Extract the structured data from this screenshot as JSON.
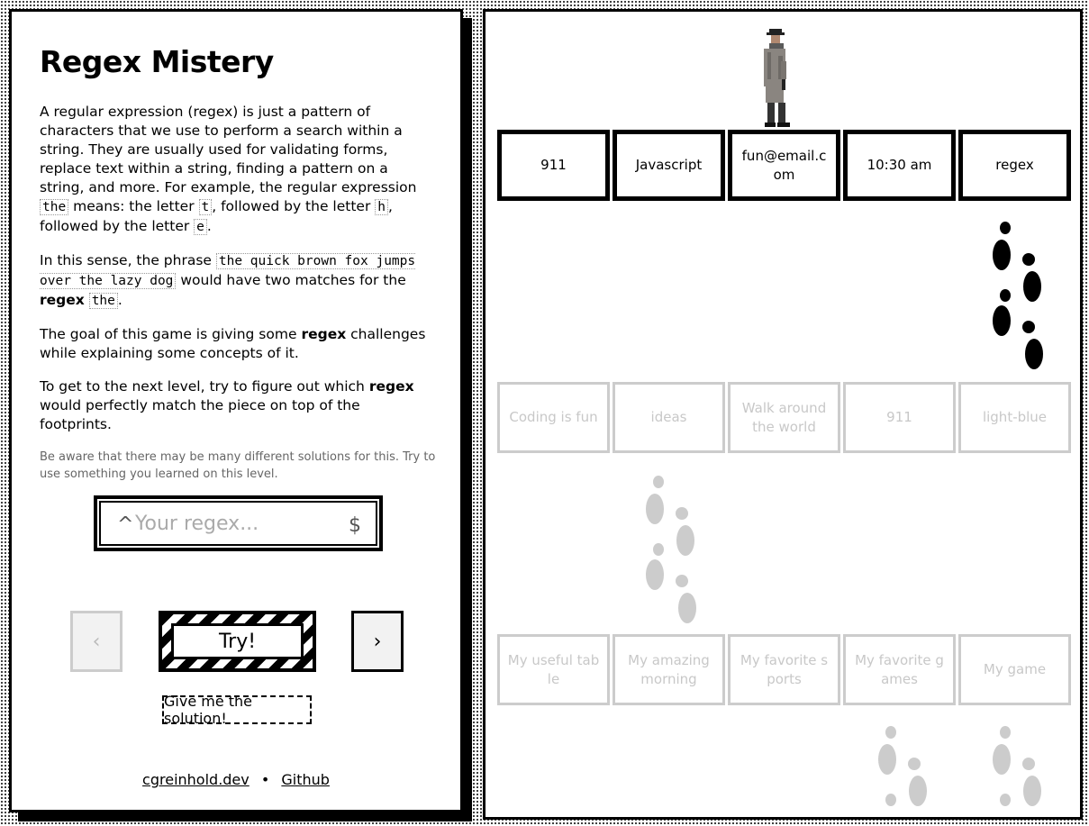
{
  "intro": {
    "title": "Regex Mistery",
    "p1_a": "A regular expression (regex) is just a pattern of characters that we use to perform a search within a string. They are usually used for validating forms, replace text within a string, finding a pattern on a string, and more. For example, the regular expression ",
    "p1_code1": "the",
    "p1_b": " means: the letter ",
    "p1_code2": "t",
    "p1_c": ", followed by the letter ",
    "p1_code3": "h",
    "p1_d": ", followed by the letter ",
    "p1_code4": "e",
    "p1_e": ".",
    "p2_a": "In this sense, the phrase ",
    "p2_code1": "the quick brown fox jumps over the lazy dog",
    "p2_b": " would have two matches for the ",
    "p2_bold": "regex",
    "p2_code2": "the",
    "p2_c": ".",
    "p3_a": "The goal of this game is giving some ",
    "p3_bold": "regex",
    "p3_b": " challenges while explaining some concepts of it.",
    "p4_a": "To get to the next level, try to figure out which ",
    "p4_bold": "regex",
    "p4_b": " would perfectly match the piece on top of the footprints.",
    "note": "Be aware that there may be many different solutions for this. Try to use something you learned on this level."
  },
  "regex_input": {
    "prefix": "^",
    "suffix": "$",
    "placeholder": "Your regex...",
    "value": ""
  },
  "controls": {
    "prev_label": "‹",
    "try_label": "Try!",
    "next_label": "›",
    "solution_label": "Give me the solution!"
  },
  "footer": {
    "link1": "cgreinhold.dev",
    "separator": "•",
    "link2": "Github"
  },
  "board": {
    "rows": [
      {
        "state": "active",
        "cells": [
          "911",
          "Javascript",
          "fun@email.com",
          "10:30 am",
          "regex"
        ]
      },
      {
        "state": "faded",
        "cells": [
          "Coding is fun",
          "ideas",
          "Walk around the world",
          "911",
          "light-blue"
        ]
      },
      {
        "state": "faded",
        "cells": [
          "My useful table",
          "My amazing morning",
          "My favorite sports",
          "My favorite games",
          "My game"
        ]
      }
    ],
    "colors": {
      "active_border": "#000000",
      "faded_border": "#cccccc",
      "faded_text": "#c8c8c8",
      "faded_footprints": "#cccccc"
    }
  }
}
